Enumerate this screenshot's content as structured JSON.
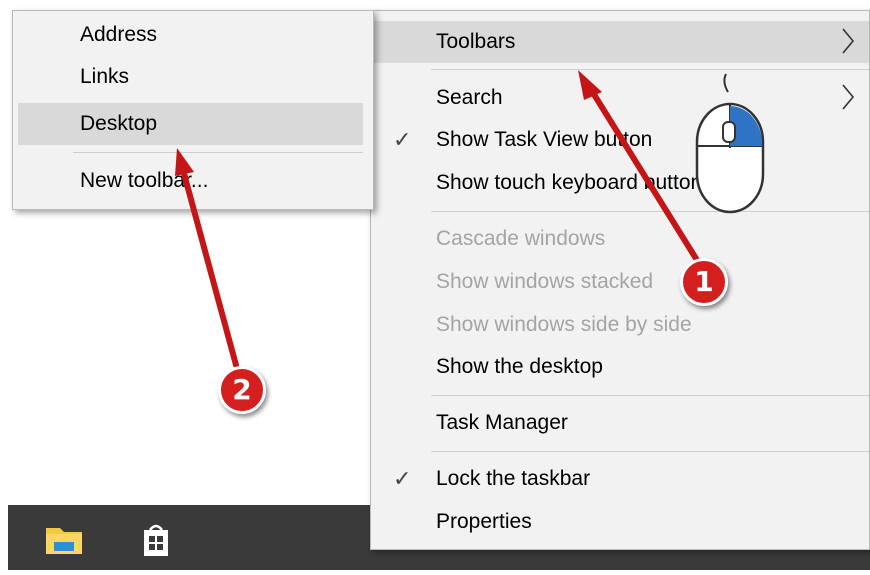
{
  "main_menu": {
    "items": [
      {
        "label": "Toolbars",
        "state": "highlighted",
        "submenu": true
      },
      {
        "label": "Search",
        "submenu": true
      },
      {
        "label": "Show Task View button",
        "checked": true
      },
      {
        "label": "Show touch keyboard button"
      },
      {
        "label": "Cascade windows",
        "disabled": true
      },
      {
        "label": "Show windows stacked",
        "disabled": true
      },
      {
        "label": "Show windows side by side",
        "disabled": true
      },
      {
        "label": "Show the desktop"
      },
      {
        "label": "Task Manager"
      },
      {
        "label": "Lock the taskbar",
        "checked": true
      },
      {
        "label": "Properties"
      }
    ],
    "check_glyph": "✓"
  },
  "toolbars_submenu": {
    "items": [
      {
        "label": "Address"
      },
      {
        "label": "Links"
      },
      {
        "label": "Desktop",
        "state": "highlighted"
      },
      {
        "label": "New toolbar..."
      }
    ]
  },
  "annotations": {
    "badge_1": "1",
    "badge_2": "2",
    "arrow_color": "#d41f1f",
    "mouse_icon": "mouse-right-click-icon"
  },
  "taskbar": {
    "icons": [
      "file-explorer-icon",
      "store-icon"
    ]
  },
  "colors": {
    "menu_bg": "#f2f2f2",
    "highlight_bg": "#d9d9d9",
    "disabled_text": "#a4a4a4",
    "taskbar_bg": "#3a3a3a"
  }
}
